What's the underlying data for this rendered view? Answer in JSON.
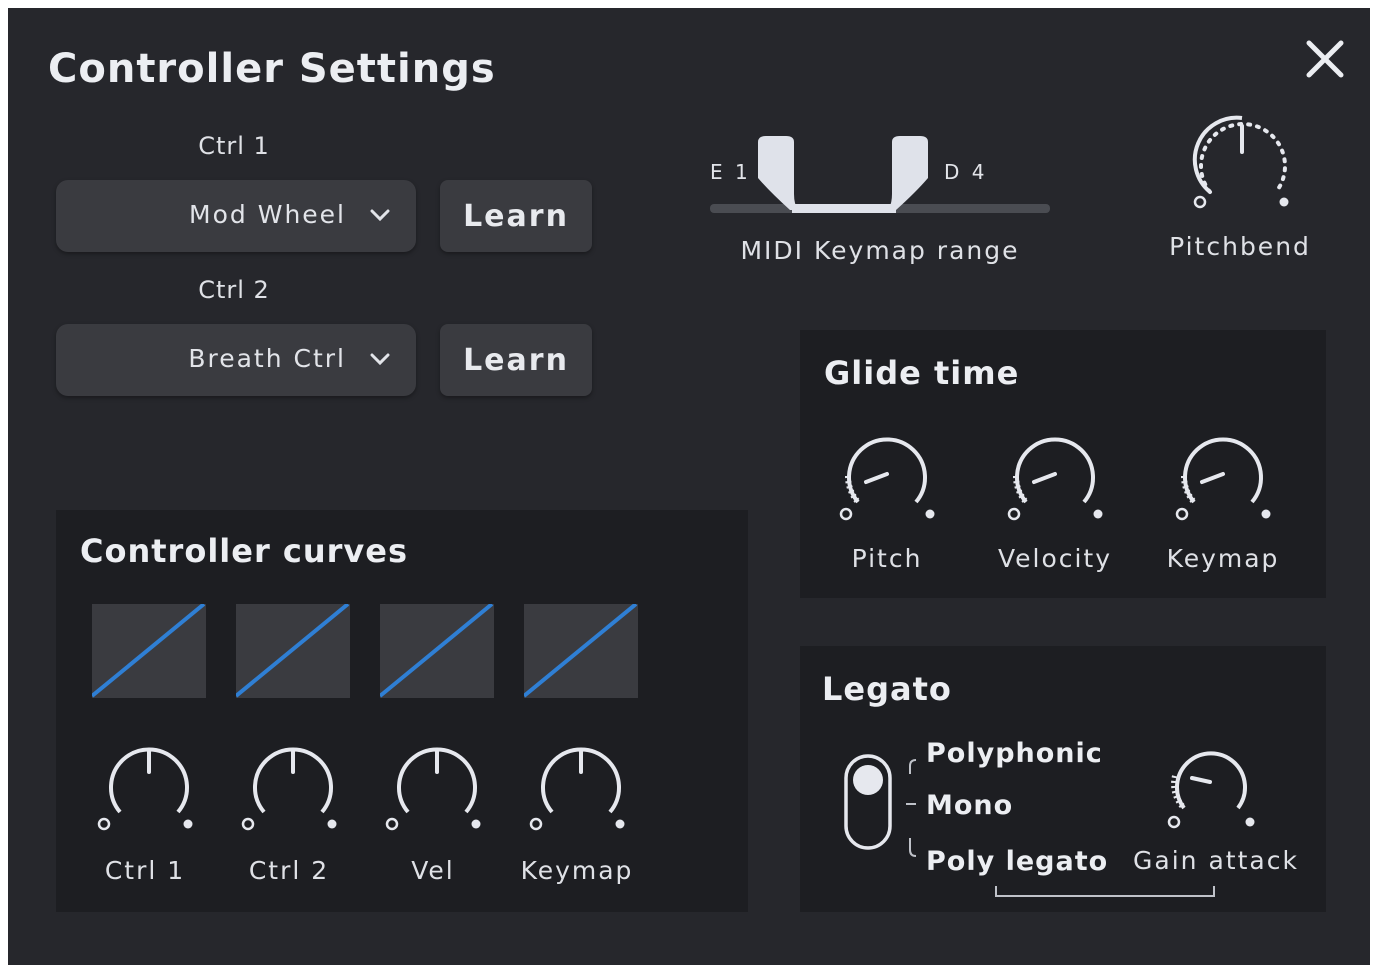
{
  "window": {
    "title": "Controller Settings",
    "close_icon": "close-icon"
  },
  "controllers": [
    {
      "label": "Ctrl 1",
      "selected": "Mod Wheel",
      "learn_label": "Learn"
    },
    {
      "label": "Ctrl 2",
      "selected": "Breath Ctrl",
      "learn_label": "Learn"
    }
  ],
  "keymap_range": {
    "low_note": "E 1",
    "high_note": "D 4",
    "label": "MIDI Keymap range"
  },
  "pitchbend": {
    "label": "Pitchbend"
  },
  "glide_time": {
    "title": "Glide time",
    "knobs": [
      {
        "label": "Pitch"
      },
      {
        "label": "Velocity"
      },
      {
        "label": "Keymap"
      }
    ]
  },
  "controller_curves": {
    "title": "Controller curves",
    "knobs": [
      {
        "label": "Ctrl 1"
      },
      {
        "label": "Ctrl 2"
      },
      {
        "label": "Vel"
      },
      {
        "label": "Keymap"
      }
    ]
  },
  "legato": {
    "title": "Legato",
    "options": [
      "Polyphonic",
      "Mono",
      "Poly legato"
    ],
    "selected_index": 0,
    "gain_attack_label": "Gain attack"
  },
  "colors": {
    "background": "#26272c",
    "section": "#1d1e22",
    "control": "#3a3b40",
    "accent_curve": "#2f7fd4",
    "text": "#e4e6ec"
  }
}
